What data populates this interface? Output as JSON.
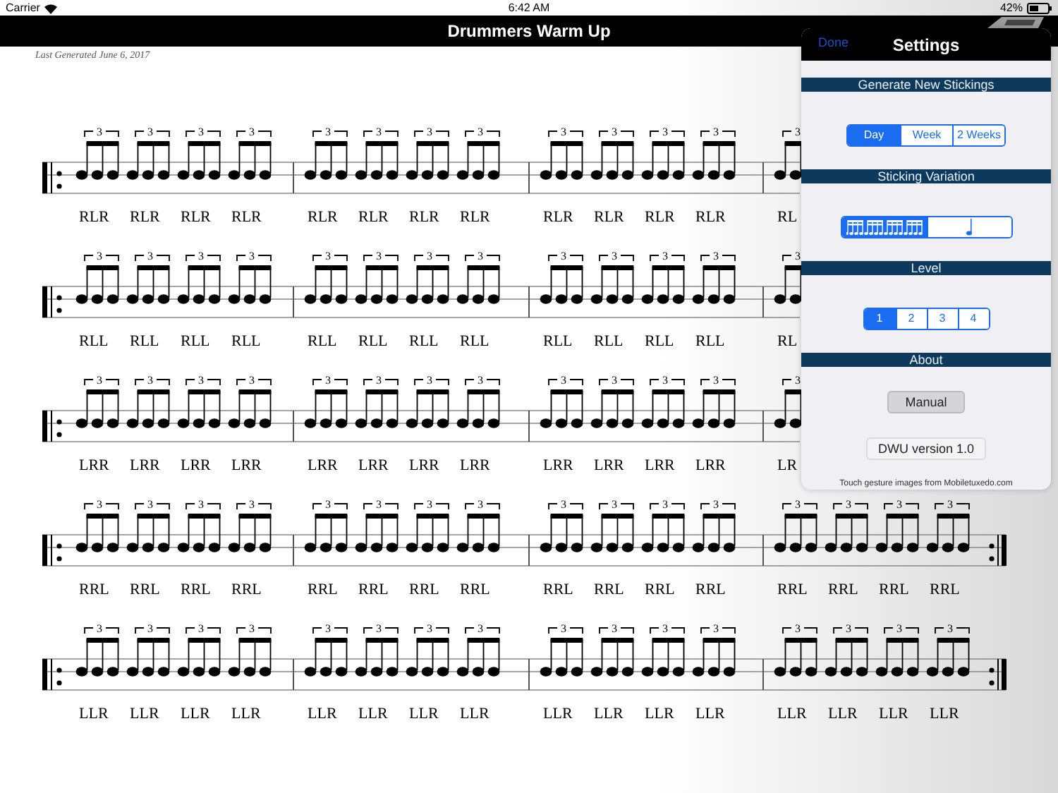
{
  "status_bar": {
    "carrier": "Carrier",
    "time": "6:42 AM",
    "battery": "42%"
  },
  "title": "Drummers Warm Up",
  "subtitle": "Last Generated June 6, 2017",
  "systems": [
    {
      "end_repeat": false,
      "measures": [
        {
          "groups": [
            {
              "sticking": "RLR",
              "tuplet": "3"
            },
            {
              "sticking": "RLR",
              "tuplet": "3"
            },
            {
              "sticking": "RLR",
              "tuplet": "3"
            },
            {
              "sticking": "RLR",
              "tuplet": "3"
            }
          ]
        },
        {
          "groups": [
            {
              "sticking": "RLR",
              "tuplet": "3"
            },
            {
              "sticking": "RLR",
              "tuplet": "3"
            },
            {
              "sticking": "RLR",
              "tuplet": "3"
            },
            {
              "sticking": "RLR",
              "tuplet": "3"
            }
          ]
        },
        {
          "groups": [
            {
              "sticking": "RLR",
              "tuplet": "3"
            },
            {
              "sticking": "RLR",
              "tuplet": "3"
            },
            {
              "sticking": "RLR",
              "tuplet": "3"
            },
            {
              "sticking": "RLR",
              "tuplet": "3"
            }
          ]
        },
        {
          "groups": [
            {
              "sticking": "RL",
              "tuplet": "3"
            }
          ]
        }
      ]
    },
    {
      "end_repeat": false,
      "measures": [
        {
          "groups": [
            {
              "sticking": "RLL",
              "tuplet": "3"
            },
            {
              "sticking": "RLL",
              "tuplet": "3"
            },
            {
              "sticking": "RLL",
              "tuplet": "3"
            },
            {
              "sticking": "RLL",
              "tuplet": "3"
            }
          ]
        },
        {
          "groups": [
            {
              "sticking": "RLL",
              "tuplet": "3"
            },
            {
              "sticking": "RLL",
              "tuplet": "3"
            },
            {
              "sticking": "RLL",
              "tuplet": "3"
            },
            {
              "sticking": "RLL",
              "tuplet": "3"
            }
          ]
        },
        {
          "groups": [
            {
              "sticking": "RLL",
              "tuplet": "3"
            },
            {
              "sticking": "RLL",
              "tuplet": "3"
            },
            {
              "sticking": "RLL",
              "tuplet": "3"
            },
            {
              "sticking": "RLL",
              "tuplet": "3"
            }
          ]
        },
        {
          "groups": [
            {
              "sticking": "RL",
              "tuplet": "3"
            }
          ]
        }
      ]
    },
    {
      "end_repeat": false,
      "measures": [
        {
          "groups": [
            {
              "sticking": "LRR",
              "tuplet": "3"
            },
            {
              "sticking": "LRR",
              "tuplet": "3"
            },
            {
              "sticking": "LRR",
              "tuplet": "3"
            },
            {
              "sticking": "LRR",
              "tuplet": "3"
            }
          ]
        },
        {
          "groups": [
            {
              "sticking": "LRR",
              "tuplet": "3"
            },
            {
              "sticking": "LRR",
              "tuplet": "3"
            },
            {
              "sticking": "LRR",
              "tuplet": "3"
            },
            {
              "sticking": "LRR",
              "tuplet": "3"
            }
          ]
        },
        {
          "groups": [
            {
              "sticking": "LRR",
              "tuplet": "3"
            },
            {
              "sticking": "LRR",
              "tuplet": "3"
            },
            {
              "sticking": "LRR",
              "tuplet": "3"
            },
            {
              "sticking": "LRR",
              "tuplet": "3"
            }
          ]
        },
        {
          "groups": [
            {
              "sticking": "LR",
              "tuplet": "3"
            }
          ]
        }
      ]
    },
    {
      "end_repeat": true,
      "measures": [
        {
          "groups": [
            {
              "sticking": "RRL",
              "tuplet": "3"
            },
            {
              "sticking": "RRL",
              "tuplet": "3"
            },
            {
              "sticking": "RRL",
              "tuplet": "3"
            },
            {
              "sticking": "RRL",
              "tuplet": "3"
            }
          ]
        },
        {
          "groups": [
            {
              "sticking": "RRL",
              "tuplet": "3"
            },
            {
              "sticking": "RRL",
              "tuplet": "3"
            },
            {
              "sticking": "RRL",
              "tuplet": "3"
            },
            {
              "sticking": "RRL",
              "tuplet": "3"
            }
          ]
        },
        {
          "groups": [
            {
              "sticking": "RRL",
              "tuplet": "3"
            },
            {
              "sticking": "RRL",
              "tuplet": "3"
            },
            {
              "sticking": "RRL",
              "tuplet": "3"
            },
            {
              "sticking": "RRL",
              "tuplet": "3"
            }
          ]
        },
        {
          "groups": [
            {
              "sticking": "RRL",
              "tuplet": "3"
            },
            {
              "sticking": "RRL",
              "tuplet": "3"
            },
            {
              "sticking": "RRL",
              "tuplet": "3"
            },
            {
              "sticking": "RRL",
              "tuplet": "3"
            }
          ]
        }
      ]
    },
    {
      "end_repeat": true,
      "measures": [
        {
          "groups": [
            {
              "sticking": "LLR",
              "tuplet": "3"
            },
            {
              "sticking": "LLR",
              "tuplet": "3"
            },
            {
              "sticking": "LLR",
              "tuplet": "3"
            },
            {
              "sticking": "LLR",
              "tuplet": "3"
            }
          ]
        },
        {
          "groups": [
            {
              "sticking": "LLR",
              "tuplet": "3"
            },
            {
              "sticking": "LLR",
              "tuplet": "3"
            },
            {
              "sticking": "LLR",
              "tuplet": "3"
            },
            {
              "sticking": "LLR",
              "tuplet": "3"
            }
          ]
        },
        {
          "groups": [
            {
              "sticking": "LLR",
              "tuplet": "3"
            },
            {
              "sticking": "LLR",
              "tuplet": "3"
            },
            {
              "sticking": "LLR",
              "tuplet": "3"
            },
            {
              "sticking": "LLR",
              "tuplet": "3"
            }
          ]
        },
        {
          "groups": [
            {
              "sticking": "LLR",
              "tuplet": "3"
            },
            {
              "sticking": "LLR",
              "tuplet": "3"
            },
            {
              "sticking": "LLR",
              "tuplet": "3"
            },
            {
              "sticking": "LLR",
              "tuplet": "3"
            }
          ]
        }
      ]
    }
  ],
  "settings": {
    "done": "Done",
    "title": "Settings",
    "sections": [
      {
        "title": "Generate New Stickings",
        "kind": "segments",
        "segments": [
          {
            "label": "Day",
            "selected": true
          },
          {
            "label": "Week",
            "selected": false
          },
          {
            "label": "2 Weeks",
            "selected": false
          }
        ]
      },
      {
        "title": "Sticking Variation",
        "kind": "icon_segments",
        "segments": [
          {
            "kind": "sixteenths",
            "selected": true
          },
          {
            "kind": "quarter",
            "selected": false
          }
        ]
      },
      {
        "title": "Level",
        "kind": "segments",
        "segments": [
          {
            "label": "1",
            "selected": true
          },
          {
            "label": "2",
            "selected": false
          },
          {
            "label": "3",
            "selected": false
          },
          {
            "label": "4",
            "selected": false
          }
        ]
      },
      {
        "title": "About",
        "kind": "about",
        "buttons": [
          {
            "label": "Manual",
            "kind": "filled"
          },
          {
            "label": "DWU version 1.0",
            "kind": "plain"
          }
        ],
        "note": "Touch gesture images from Mobiletuxedo.com"
      }
    ]
  }
}
